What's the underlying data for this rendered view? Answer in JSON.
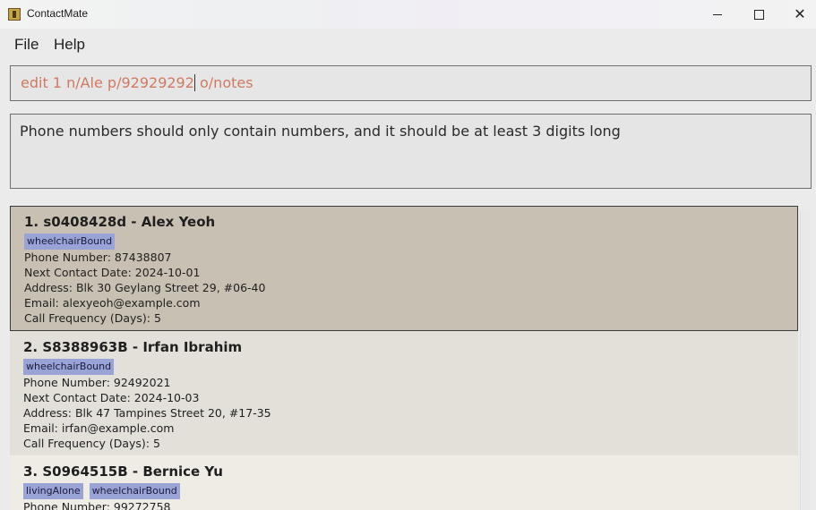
{
  "window": {
    "title": "ContactMate",
    "min_icon": "minimize-icon",
    "max_icon": "maximize-icon",
    "close_icon": "close-icon",
    "close_glyph": "✕"
  },
  "menu": {
    "file": "File",
    "help": "Help"
  },
  "command": {
    "before_caret": "edit 1 n/Ale p/92929292",
    "after_caret": " o/notes",
    "text_color": "#cf7a62"
  },
  "result": {
    "message": "Phone numbers should only contain numbers, and it should be at least 3 digits long"
  },
  "persons": [
    {
      "header": "1. s0408428d - Alex Yeoh",
      "tags": [
        "wheelchairBound"
      ],
      "phone": "Phone Number: 87438807",
      "next_contact": "Next Contact Date: 2024-10-01",
      "address": "Address: Blk 30 Geylang Street 29, #06-40",
      "email": "Email: alexyeoh@example.com",
      "call_frequency": "Call Frequency (Days): 5"
    },
    {
      "header": "2. S8388963B - Irfan Ibrahim",
      "tags": [
        "wheelchairBound"
      ],
      "phone": "Phone Number: 92492021",
      "next_contact": "Next Contact Date: 2024-10-03",
      "address": "Address: Blk 47 Tampines Street 20, #17-35",
      "email": "Email: irfan@example.com",
      "call_frequency": "Call Frequency (Days): 5"
    },
    {
      "header": "3. S0964515B - Bernice Yu",
      "tags": [
        "livingAlone",
        "wheelchairBound"
      ],
      "phone": "Phone Number: 99272758"
    }
  ],
  "colors": {
    "selected_card": "#c8c0b3",
    "card": "#e3e0da",
    "tag": "#9aa3d6"
  }
}
